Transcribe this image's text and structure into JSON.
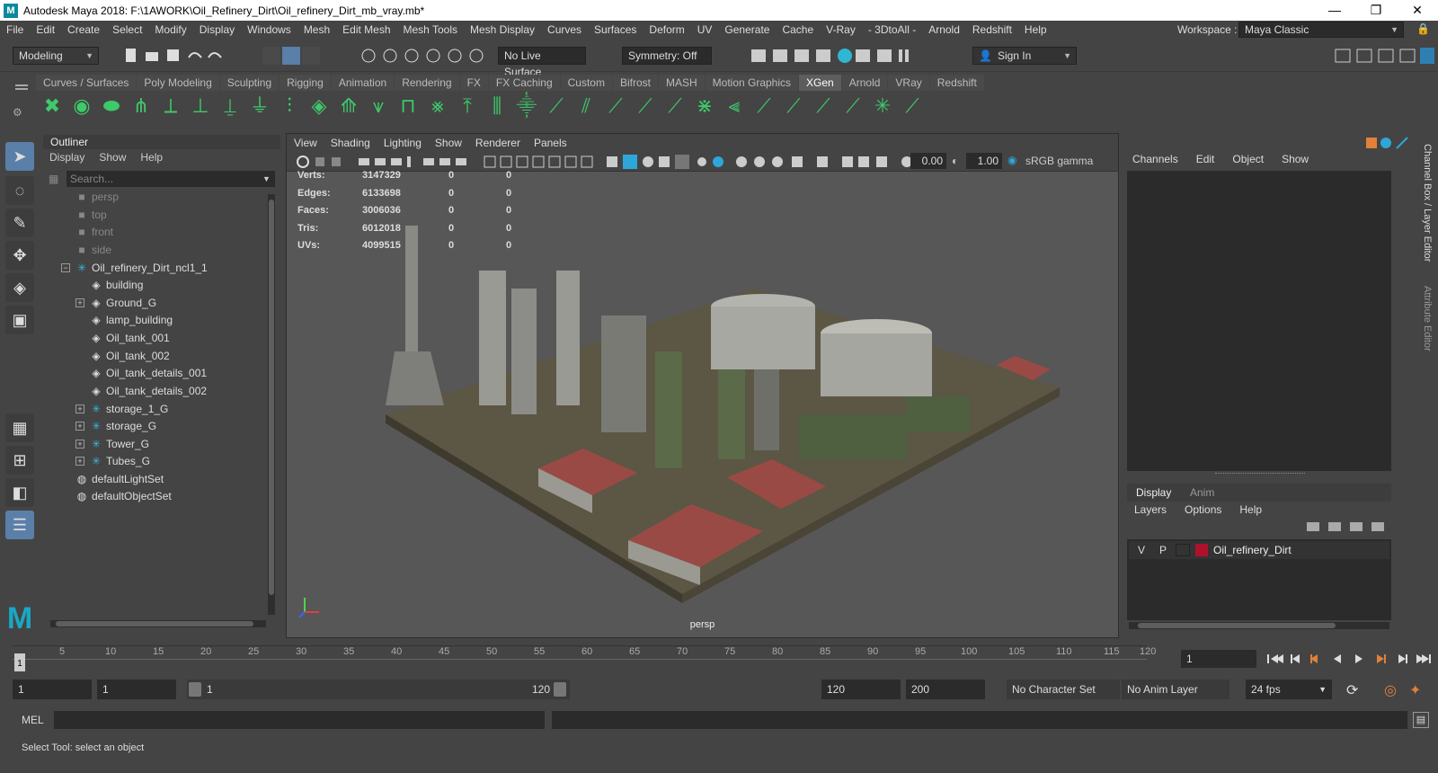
{
  "titlebar": {
    "title": "Autodesk Maya 2018: F:\\1AWORK\\Oil_Refinery_Dirt\\Oil_refinery_Dirt_mb_vray.mb*",
    "minimize": "—",
    "maximize": "❐",
    "close": "✕"
  },
  "menus": [
    "File",
    "Edit",
    "Create",
    "Select",
    "Modify",
    "Display",
    "Windows",
    "Mesh",
    "Edit Mesh",
    "Mesh Tools",
    "Mesh Display",
    "Curves",
    "Surfaces",
    "Deform",
    "UV",
    "Generate",
    "Cache",
    "V-Ray",
    "- 3DtoAll -",
    "Arnold",
    "Redshift",
    "Help"
  ],
  "workspace": {
    "label": "Workspace :",
    "value": "Maya Classic"
  },
  "statusline": {
    "mode": "Modeling",
    "live_surface": "No Live Surface",
    "symmetry": "Symmetry: Off",
    "sign_in": "Sign In"
  },
  "shelf_tabs": [
    "Curves / Surfaces",
    "Poly Modeling",
    "Sculpting",
    "Rigging",
    "Animation",
    "Rendering",
    "FX",
    "FX Caching",
    "Custom",
    "Bifrost",
    "MASH",
    "Motion Graphics",
    "XGen",
    "Arnold",
    "VRay",
    "Redshift"
  ],
  "active_shelf_tab": "XGen",
  "outliner": {
    "title": "Outliner",
    "menu": [
      "Display",
      "Show",
      "Help"
    ],
    "search_placeholder": "Search...",
    "cameras": [
      "persp",
      "top",
      "front",
      "side"
    ],
    "root": "Oil_refinery_Dirt_ncl1_1",
    "children": [
      "building",
      "Ground_G",
      "lamp_building",
      "Oil_tank_001",
      "Oil_tank_002",
      "Oil_tank_details_001",
      "Oil_tank_details_002",
      "storage_1_G",
      "storage_G",
      "Tower_G",
      "Tubes_G"
    ],
    "sets": [
      "defaultLightSet",
      "defaultObjectSet"
    ]
  },
  "viewport": {
    "menu": [
      "View",
      "Shading",
      "Lighting",
      "Show",
      "Renderer",
      "Panels"
    ],
    "exposure": "0.00",
    "gamma": "1.00",
    "colorspace": "sRGB gamma",
    "camera_label": "persp",
    "hud": [
      {
        "label": "Verts:",
        "value": "3147329",
        "a": "0",
        "b": "0"
      },
      {
        "label": "Edges:",
        "value": "6133698",
        "a": "0",
        "b": "0"
      },
      {
        "label": "Faces:",
        "value": "3006036",
        "a": "0",
        "b": "0"
      },
      {
        "label": "Tris:",
        "value": "6012018",
        "a": "0",
        "b": "0"
      },
      {
        "label": "UVs:",
        "value": "4099515",
        "a": "0",
        "b": "0"
      }
    ]
  },
  "channelbox": {
    "menu": [
      "Channels",
      "Edit",
      "Object",
      "Show"
    ],
    "side_tabs": [
      "Channel Box / Layer Editor",
      "Attribute Editor"
    ]
  },
  "layers": {
    "tabs": [
      "Display",
      "Anim"
    ],
    "menu": [
      "Layers",
      "Options",
      "Help"
    ],
    "layer": {
      "v": "V",
      "p": "P",
      "name": "Oil_refinery_Dirt",
      "color": "#b0112a"
    }
  },
  "timeline": {
    "ticks": [
      "5",
      "10",
      "15",
      "20",
      "25",
      "30",
      "35",
      "40",
      "45",
      "50",
      "55",
      "60",
      "65",
      "70",
      "75",
      "80",
      "85",
      "90",
      "95",
      "100",
      "105",
      "110",
      "115",
      "120"
    ],
    "current_marker": "1",
    "current_frame": "1"
  },
  "range": {
    "start": "1",
    "anim_start": "1",
    "slider_start": "1",
    "slider_end": "120",
    "end": "120",
    "anim_end": "200",
    "character_set": "No Character Set",
    "anim_layer": "No Anim Layer",
    "fps": "24 fps"
  },
  "cmdline": {
    "label": "MEL"
  },
  "helpline": {
    "text": "Select Tool: select an object"
  }
}
